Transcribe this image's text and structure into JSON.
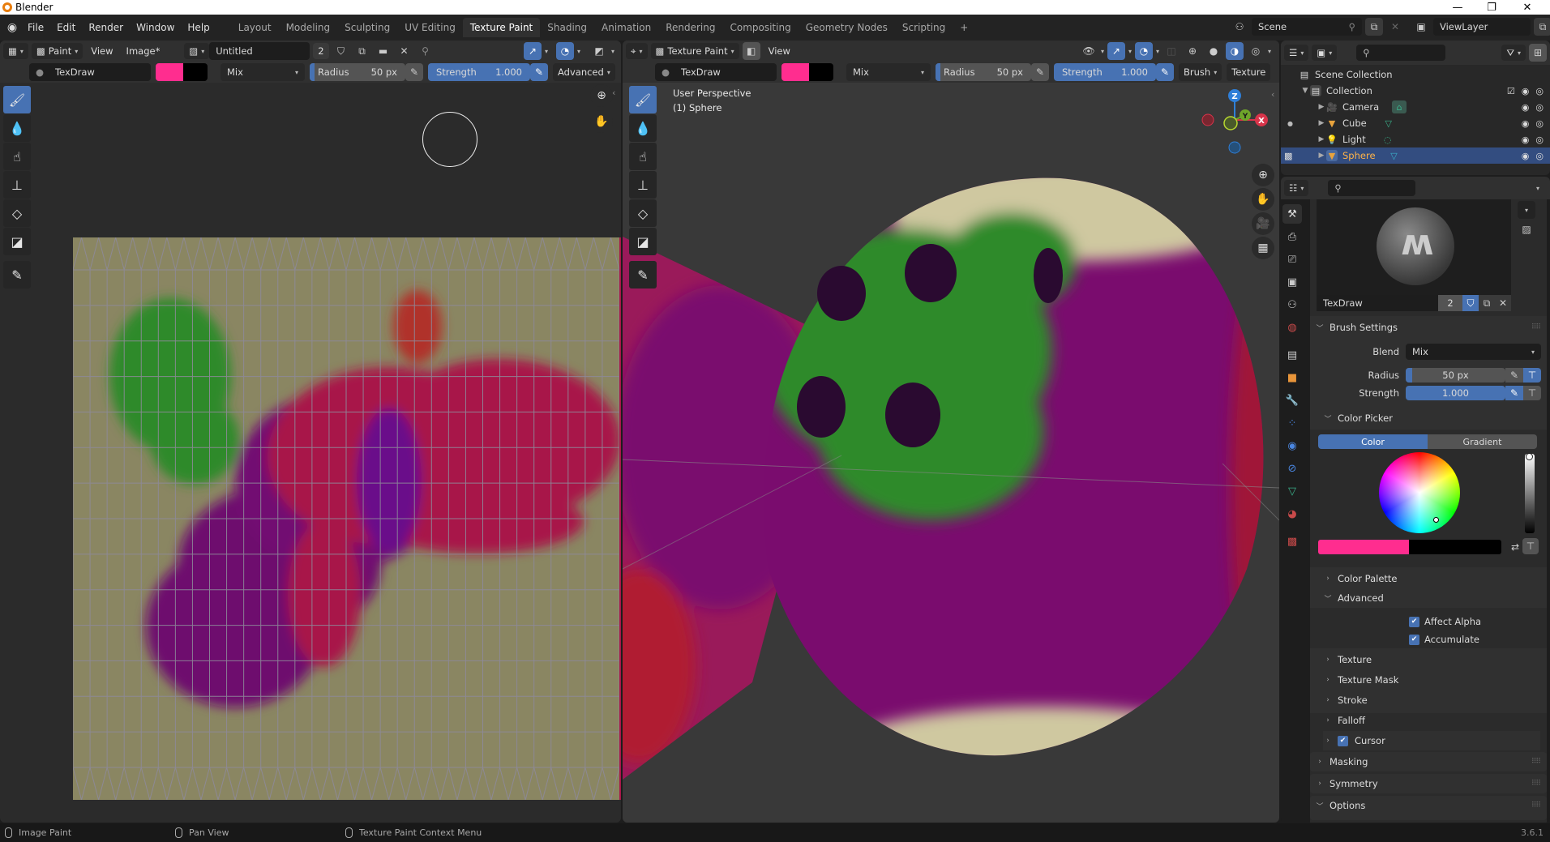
{
  "window": {
    "title": "Blender",
    "controls": {
      "minimize": "—",
      "maximize": "❐",
      "close": "✕"
    }
  },
  "menu": [
    "File",
    "Edit",
    "Render",
    "Window",
    "Help"
  ],
  "workspaces": [
    "Layout",
    "Modeling",
    "Sculpting",
    "UV Editing",
    "Texture Paint",
    "Shading",
    "Animation",
    "Rendering",
    "Compositing",
    "Geometry Nodes",
    "Scripting"
  ],
  "active_workspace": "Texture Paint",
  "add_workspace": "+",
  "scene": {
    "label": "Scene",
    "view_layer": "ViewLayer"
  },
  "image_editor": {
    "mode": "Paint",
    "menus": [
      "View",
      "Image*"
    ],
    "image_name": "Untitled",
    "users": "2",
    "tool_settings": {
      "brush": "TexDraw",
      "primary_color": "#ff2d8f",
      "secondary_color": "#000000",
      "blend": "Mix",
      "radius_label": "Radius",
      "radius_value": "50 px",
      "radius_fraction": 0.05,
      "strength_label": "Strength",
      "strength_value": "1.000",
      "strength_fraction": 1.0,
      "advanced": "Advanced"
    },
    "tools": [
      "draw-brush",
      "soften",
      "smear",
      "clone",
      "fill",
      "mask",
      "annotate"
    ]
  },
  "viewport": {
    "mode": "Texture Paint",
    "menus": [
      "View"
    ],
    "overlay_text": [
      "User Perspective",
      "(1) Sphere"
    ],
    "tool_settings": {
      "brush": "TexDraw",
      "blend": "Mix",
      "radius_label": "Radius",
      "radius_value": "50 px",
      "strength_label": "Strength",
      "strength_value": "1.000",
      "brush_menu": "Brush",
      "texture_menu": "Texture"
    },
    "gizmo": {
      "z": "Z",
      "x": "X",
      "y": "Y"
    }
  },
  "outliner": {
    "root": "Scene Collection",
    "collection": "Collection",
    "items": [
      {
        "name": "Camera",
        "icon": "camera-icon"
      },
      {
        "name": "Cube",
        "icon": "mesh-icon"
      },
      {
        "name": "Light",
        "icon": "light-icon"
      },
      {
        "name": "Sphere",
        "icon": "mesh-icon",
        "selected": true
      }
    ]
  },
  "properties": {
    "brush_name": "TexDraw",
    "brush_users": "2",
    "brush_settings": "Brush Settings",
    "blend_label": "Blend",
    "blend_value": "Mix",
    "radius_label": "Radius",
    "radius_value": "50 px",
    "strength_label": "Strength",
    "strength_value": "1.000",
    "color_picker": "Color Picker",
    "color_tab": "Color",
    "gradient_tab": "Gradient",
    "color_palette": "Color Palette",
    "advanced": "Advanced",
    "affect_alpha": "Affect Alpha",
    "accumulate": "Accumulate",
    "subpanels": [
      "Texture",
      "Texture Mask",
      "Stroke",
      "Falloff"
    ],
    "cursor": "Cursor",
    "panels": [
      "Masking",
      "Symmetry",
      "Options"
    ]
  },
  "status": {
    "left": "Image Paint",
    "middle": "Pan View",
    "right": "Texture Paint Context Menu",
    "version": "3.6.1"
  }
}
